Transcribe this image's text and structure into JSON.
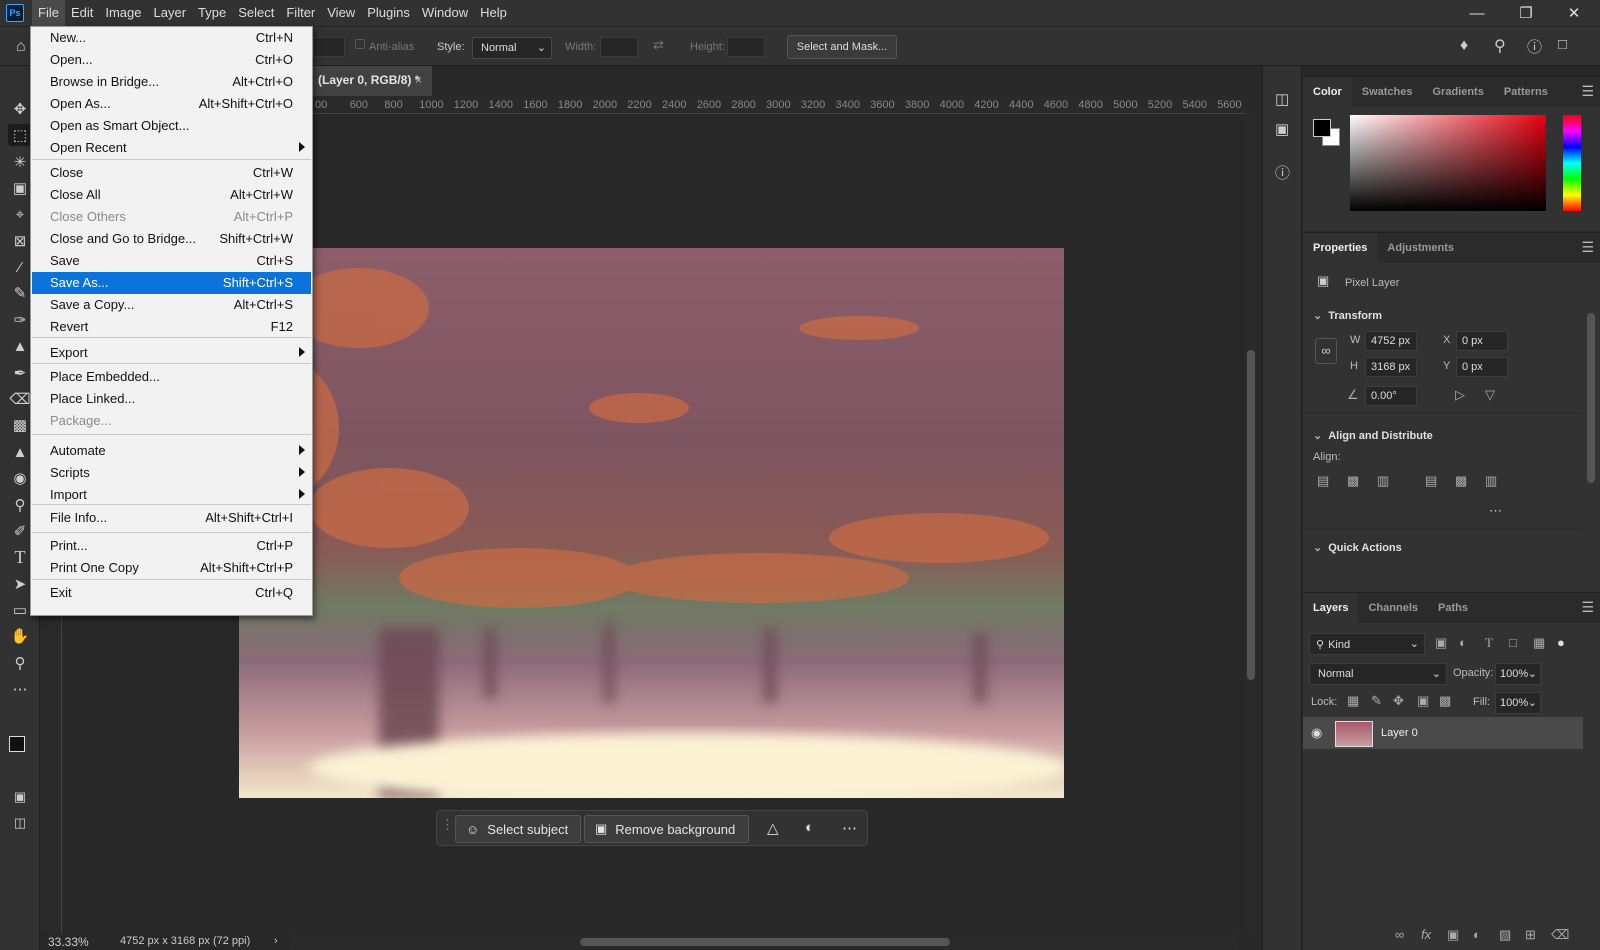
{
  "menubar": {
    "logo": "Ps",
    "items": [
      "File",
      "Edit",
      "Image",
      "Layer",
      "Type",
      "Select",
      "Filter",
      "View",
      "Plugins",
      "Window",
      "Help"
    ]
  },
  "options": {
    "antialias": "Anti-alias",
    "style_label": "Style:",
    "style_value": "Normal",
    "width_label": "Width:",
    "height_label": "Height:",
    "select_mask": "Select and Mask..."
  },
  "doc_tab": {
    "title": "(Layer 0, RGB/8) *",
    "close": "×"
  },
  "ruler_ticks": [
    "00",
    "600",
    "800",
    "1000",
    "1200",
    "1400",
    "1600",
    "1800",
    "2000",
    "2200",
    "2400",
    "2600",
    "2800",
    "3000",
    "3200",
    "3400",
    "3600",
    "3800",
    "4000",
    "4200",
    "4400",
    "4600",
    "4800",
    "5000",
    "5200",
    "5400",
    "5600"
  ],
  "file_menu": [
    {
      "label": "New...",
      "key": "Ctrl+N"
    },
    {
      "label": "Open...",
      "key": "Ctrl+O"
    },
    {
      "label": "Browse in Bridge...",
      "key": "Alt+Ctrl+O"
    },
    {
      "label": "Open As...",
      "key": "Alt+Shift+Ctrl+O"
    },
    {
      "label": "Open as Smart Object...",
      "key": ""
    },
    {
      "label": "Open Recent",
      "key": ""
    },
    {
      "label": "Close",
      "key": "Ctrl+W"
    },
    {
      "label": "Close All",
      "key": "Alt+Ctrl+W"
    },
    {
      "label": "Close Others",
      "key": "Alt+Ctrl+P"
    },
    {
      "label": "Close and Go to Bridge...",
      "key": "Shift+Ctrl+W"
    },
    {
      "label": "Save",
      "key": "Ctrl+S"
    },
    {
      "label": "Save As...",
      "key": "Shift+Ctrl+S"
    },
    {
      "label": "Save a Copy...",
      "key": "Alt+Ctrl+S"
    },
    {
      "label": "Revert",
      "key": "F12"
    },
    {
      "label": "Export",
      "key": ""
    },
    {
      "label": "Place Embedded...",
      "key": ""
    },
    {
      "label": "Place Linked...",
      "key": ""
    },
    {
      "label": "Package...",
      "key": ""
    },
    {
      "label": "Automate",
      "key": ""
    },
    {
      "label": "Scripts",
      "key": ""
    },
    {
      "label": "Import",
      "key": ""
    },
    {
      "label": "File Info...",
      "key": "Alt+Shift+Ctrl+I"
    },
    {
      "label": "Print...",
      "key": "Ctrl+P"
    },
    {
      "label": "Print One Copy",
      "key": "Alt+Shift+Ctrl+P"
    },
    {
      "label": "Exit",
      "key": "Ctrl+Q"
    }
  ],
  "context_bar": {
    "select_subject": "Select subject",
    "remove_background": "Remove background"
  },
  "status": {
    "zoom": "33.33%",
    "info": "4752 px x 3168 px (72 ppi)"
  },
  "color_panel": {
    "tabs": [
      "Color",
      "Swatches",
      "Gradients",
      "Patterns"
    ]
  },
  "properties_panel": {
    "tabs": [
      "Properties",
      "Adjustments"
    ],
    "kind": "Pixel Layer",
    "transform": "Transform",
    "w_label": "W",
    "w": "4752 px",
    "h_label": "H",
    "h": "3168 px",
    "x_label": "X",
    "x": "0 px",
    "y_label": "Y",
    "y": "0 px",
    "angle": "0.00°",
    "align_distribute": "Align and Distribute",
    "align_label": "Align:",
    "quick_actions": "Quick Actions"
  },
  "layers_panel": {
    "tabs": [
      "Layers",
      "Channels",
      "Paths"
    ],
    "kind": "Kind",
    "blend": "Normal",
    "opacity_label": "Opacity:",
    "opacity": "100%",
    "lock_label": "Lock:",
    "fill_label": "Fill:",
    "fill": "100%",
    "layer_name": "Layer 0"
  },
  "colors": {
    "accent": "#0b73d9",
    "bg": "#282828",
    "panel": "#323232"
  }
}
